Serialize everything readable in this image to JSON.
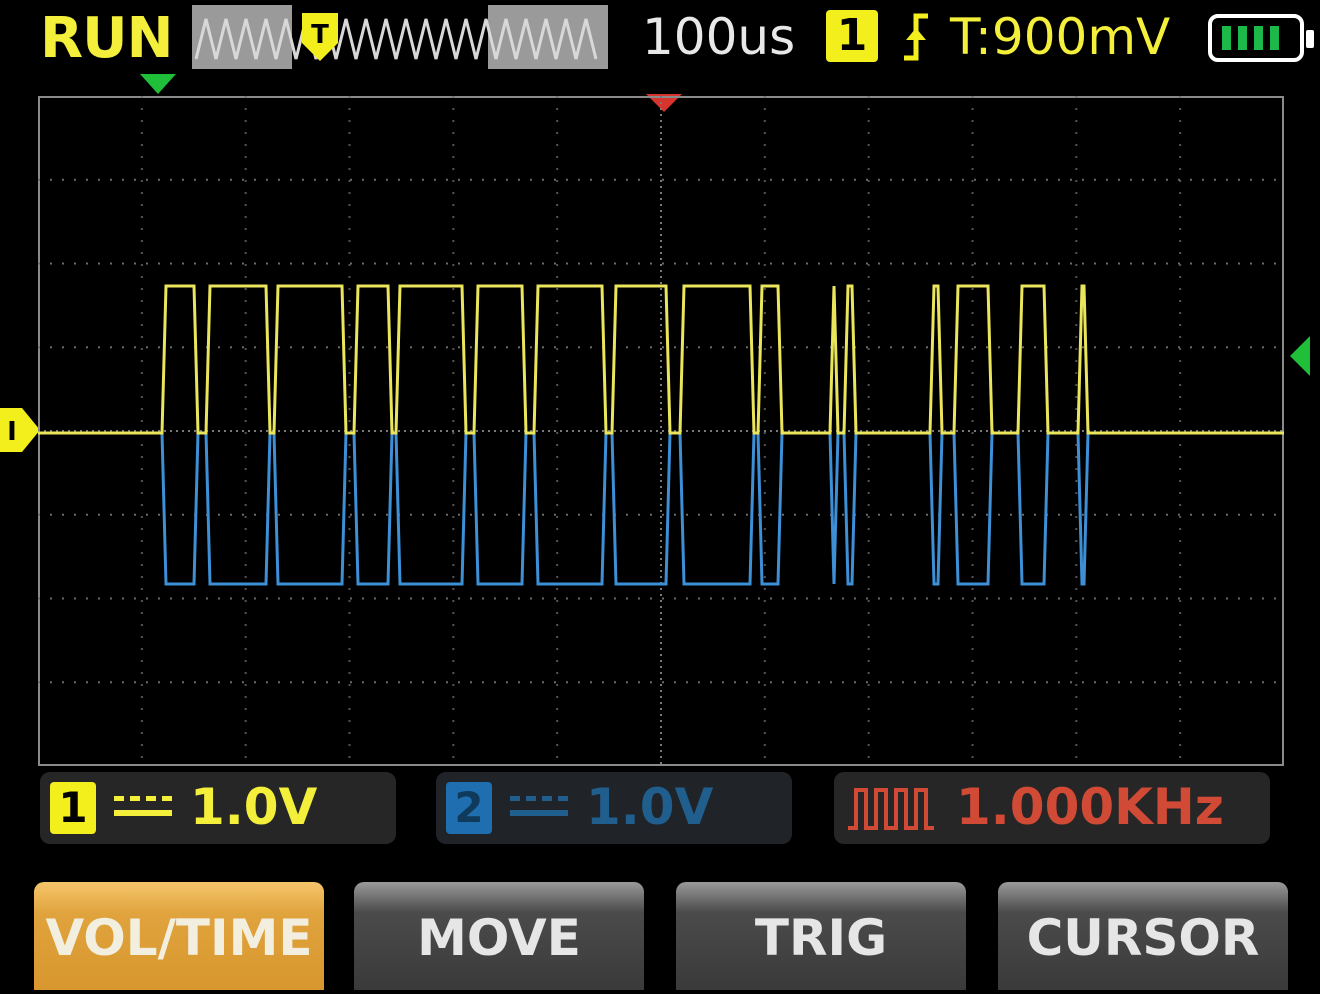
{
  "status": {
    "run_state": "RUN",
    "timebase": "100us",
    "trigger_channel": "1",
    "trigger_edge_icon": "rising-edge-icon",
    "trigger_level": "T:900mV",
    "battery_level": 1.0
  },
  "memory_map": {
    "trigger_label": "T"
  },
  "channels": [
    {
      "id": "1",
      "coupling_icon": "dc-coupling-icon",
      "scale": "1.0V",
      "color": "#f3ef3a",
      "enabled": true
    },
    {
      "id": "2",
      "coupling_icon": "dc-coupling-icon",
      "scale": "1.0V",
      "color": "#3d9be0",
      "enabled": false
    }
  ],
  "measurement": {
    "icon": "square-wave-icon",
    "frequency": "1.000KHz",
    "color": "#d04a36"
  },
  "ch1_marker_label": "I",
  "softkeys": [
    {
      "label": "VOL/TIME",
      "active": true
    },
    {
      "label": "MOVE",
      "active": false
    },
    {
      "label": "TRIG",
      "active": false
    },
    {
      "label": "CURSOR",
      "active": false
    }
  ]
}
